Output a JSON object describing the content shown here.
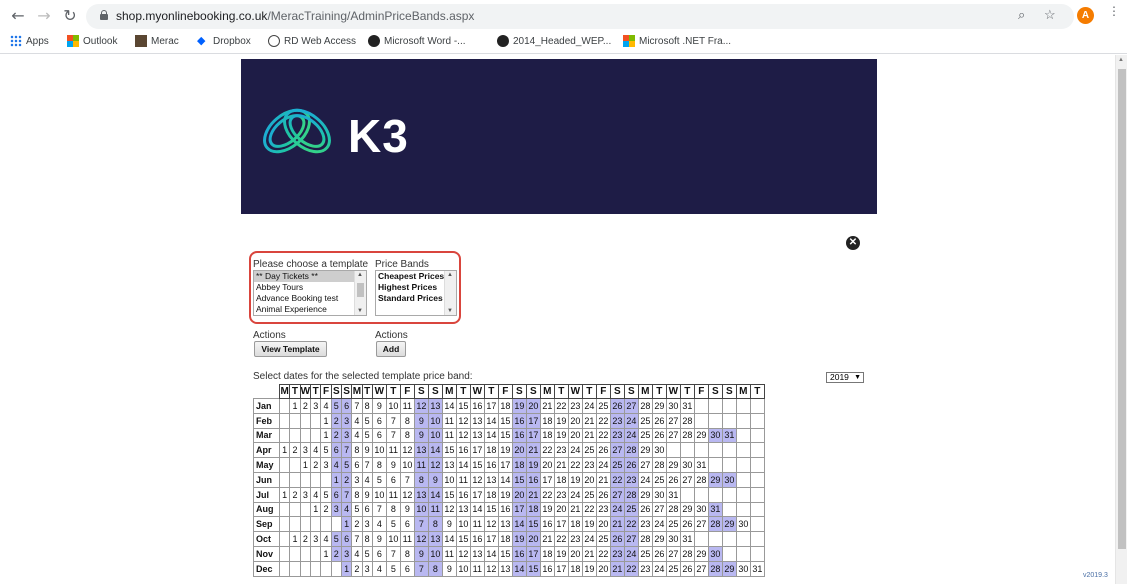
{
  "browser": {
    "url_domain": "shop.myonlinebooking.co.uk",
    "url_path": "/MeracTraining/AdminPriceBands.aspx",
    "avatar_letter": "A"
  },
  "bookmarks": [
    "Apps",
    "Outlook",
    "Merac",
    "Dropbox",
    "RD Web Access",
    "Microsoft Word -...",
    "2014_Headed_WEP...",
    "Microsoft .NET Fra..."
  ],
  "brand": {
    "logo_text": "K3",
    "banner_color": "#1e1c46"
  },
  "form": {
    "template_label": "Please choose a template",
    "price_bands_label": "Price Bands",
    "templates": [
      "** Day Tickets **",
      "Abbey Tours",
      "Advance Booking test",
      "Animal Experience"
    ],
    "selected_template": "** Day Tickets **",
    "price_bands": [
      "Cheapest Prices",
      "Highest Prices",
      "Standard Prices"
    ],
    "actions_label_1": "Actions",
    "actions_label_2": "Actions",
    "view_template_button": "View Template",
    "add_button": "Add"
  },
  "calendar": {
    "instruction": "Select dates for the selected template price band:",
    "year": "2019",
    "weekday_headers": [
      "M",
      "T",
      "W",
      "T",
      "F",
      "S",
      "S",
      "M",
      "T",
      "W",
      "T",
      "F",
      "S",
      "S",
      "M",
      "T",
      "W",
      "T",
      "F",
      "S",
      "S",
      "M",
      "T",
      "W",
      "T",
      "F",
      "S",
      "S",
      "M",
      "T",
      "W",
      "T",
      "F",
      "S",
      "S",
      "M",
      "T"
    ],
    "months": [
      {
        "name": "Jan",
        "offset": 1,
        "days": 31
      },
      {
        "name": "Feb",
        "offset": 4,
        "days": 28
      },
      {
        "name": "Mar",
        "offset": 4,
        "days": 31
      },
      {
        "name": "Apr",
        "offset": 0,
        "days": 30
      },
      {
        "name": "May",
        "offset": 2,
        "days": 31
      },
      {
        "name": "Jun",
        "offset": 5,
        "days": 30
      },
      {
        "name": "Jul",
        "offset": 0,
        "days": 31
      },
      {
        "name": "Aug",
        "offset": 3,
        "days": 31
      },
      {
        "name": "Sep",
        "offset": 6,
        "days": 30
      },
      {
        "name": "Oct",
        "offset": 1,
        "days": 31
      },
      {
        "name": "Nov",
        "offset": 4,
        "days": 30
      },
      {
        "name": "Dec",
        "offset": 6,
        "days": 31
      }
    ],
    "weekend_color": "#b9b8f1"
  },
  "footer": {
    "version": "v2019.3"
  }
}
